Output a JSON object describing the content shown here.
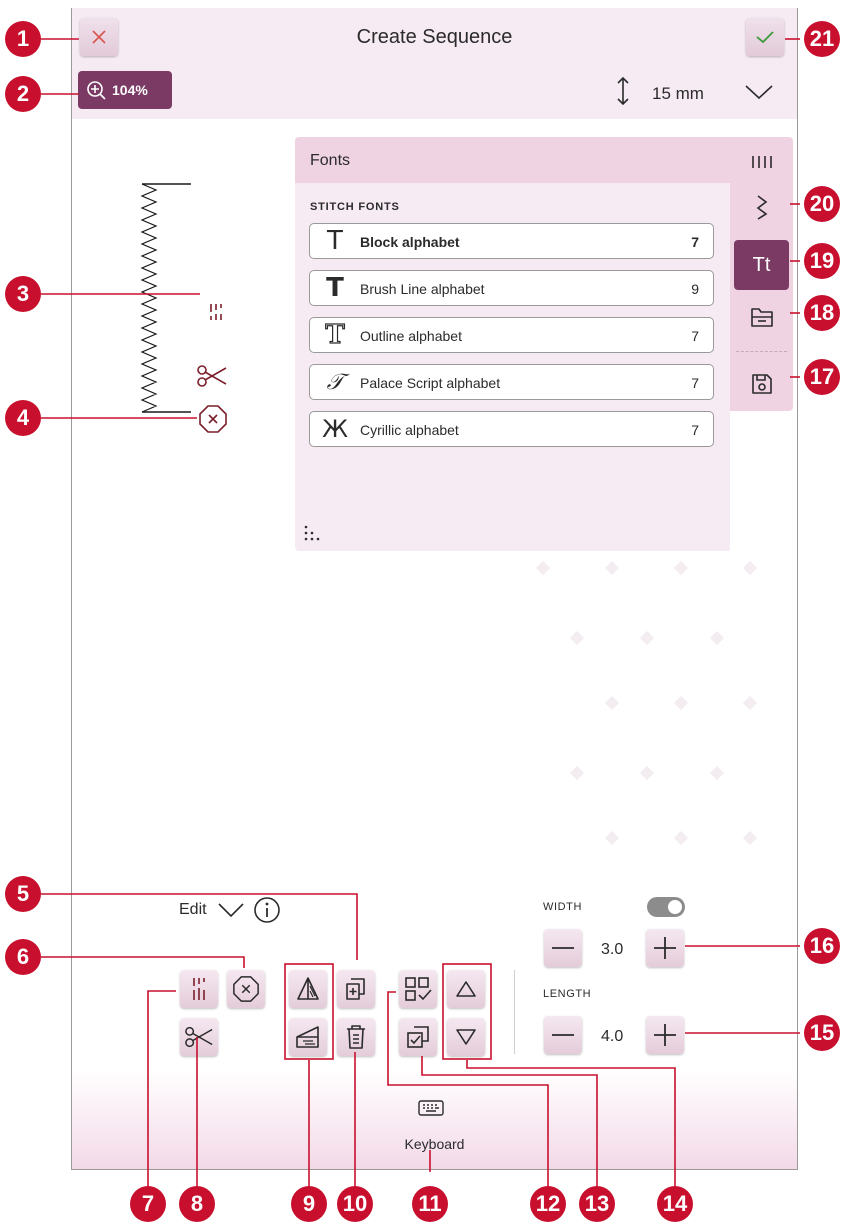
{
  "header": {
    "title": "Create Sequence",
    "zoom_label": "104%",
    "height_value": "15 mm"
  },
  "fonts_panel": {
    "title": "Fonts",
    "section_label": "STITCH FONTS",
    "items": [
      {
        "name": "Block alphabet",
        "count": "7",
        "icon": "T"
      },
      {
        "name": "Brush Line alphabet",
        "count": "9",
        "icon": "T"
      },
      {
        "name": "Outline alphabet",
        "count": "7",
        "icon": "T"
      },
      {
        "name": "Palace Script alphabet",
        "count": "7",
        "icon": "𝒯"
      },
      {
        "name": "Cyrillic alphabet",
        "count": "7",
        "icon": "Ж"
      }
    ],
    "side_tabs": {
      "active_label": "Tt"
    }
  },
  "edit": {
    "label": "Edit"
  },
  "width": {
    "label": "WIDTH",
    "value": "3.0"
  },
  "length": {
    "label": "LENGTH",
    "value": "4.0"
  },
  "footer": {
    "keyboard_label": "Keyboard"
  },
  "callouts": [
    "1",
    "2",
    "3",
    "4",
    "5",
    "6",
    "7",
    "8",
    "9",
    "10",
    "11",
    "12",
    "13",
    "14",
    "15",
    "16",
    "17",
    "18",
    "19",
    "20",
    "21"
  ],
  "colors": {
    "accent": "#7a3a63",
    "callout": "#c8102e",
    "stitch": "#7a1f2b",
    "confirm": "#3c9a3c",
    "cancel": "#d9534f"
  }
}
